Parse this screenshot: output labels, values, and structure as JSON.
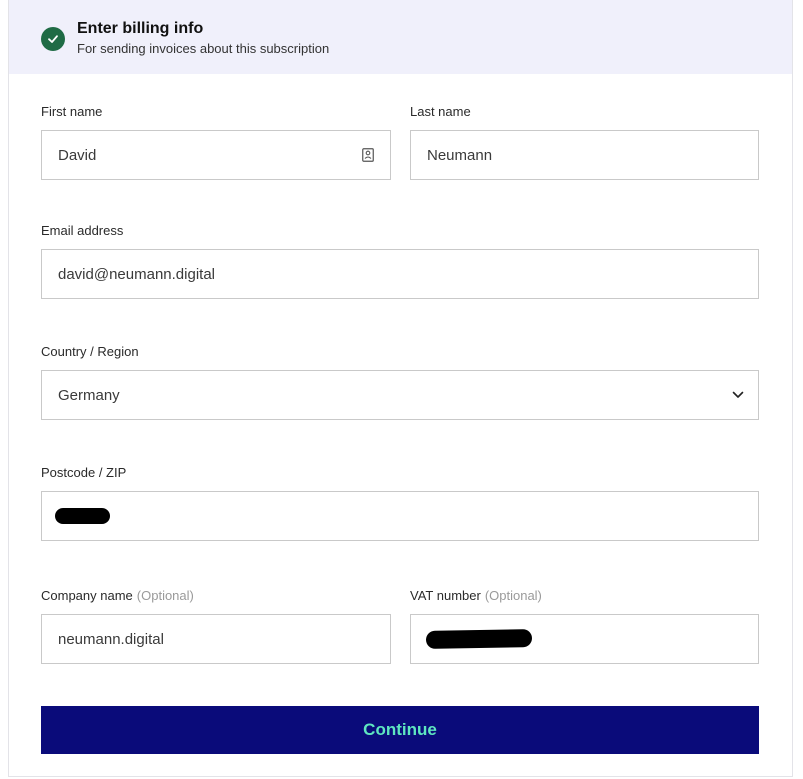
{
  "header": {
    "title": "Enter billing info",
    "subtitle": "For sending invoices about this subscription",
    "status_icon": "check-circle-icon",
    "status_color": "#1f6b45",
    "background": "#f0f0fb"
  },
  "form": {
    "first_name": {
      "label": "First name",
      "value": "David",
      "icon": "contact-card-icon"
    },
    "last_name": {
      "label": "Last name",
      "value": "Neumann"
    },
    "email": {
      "label": "Email address",
      "value": "david@neumann.digital"
    },
    "country": {
      "label": "Country / Region",
      "value": "Germany",
      "icon": "chevron-down-icon"
    },
    "postcode": {
      "label": "Postcode / ZIP",
      "value_redacted": true
    },
    "company": {
      "label": "Company name",
      "optional_hint": "(Optional)",
      "value": "neumann.digital"
    },
    "vat": {
      "label": "VAT number",
      "optional_hint": "(Optional)",
      "value_redacted": true
    }
  },
  "actions": {
    "continue_label": "Continue",
    "continue_bg": "#0a0b7a",
    "continue_text_color": "#5ee6c0"
  }
}
